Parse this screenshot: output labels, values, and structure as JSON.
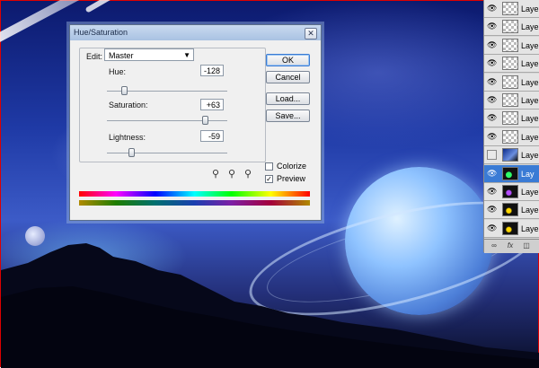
{
  "dialog": {
    "title": "Hue/Saturation",
    "edit_label": "Edit:",
    "edit_value": "Master",
    "hue": {
      "label": "Hue:",
      "value": "-128",
      "level": -128,
      "min": -180,
      "max": 180
    },
    "saturation": {
      "label": "Saturation:",
      "value": "+63",
      "level": 63,
      "min": -100,
      "max": 100
    },
    "lightness": {
      "label": "Lightness:",
      "value": "-59",
      "level": -59,
      "min": -100,
      "max": 100
    },
    "buttons": {
      "ok": "OK",
      "cancel": "Cancel",
      "load": "Load...",
      "save": "Save..."
    },
    "colorize": {
      "label": "Colorize",
      "checked": false
    },
    "preview": {
      "label": "Preview",
      "checked": true
    },
    "close_icon": "close-icon",
    "eyedropper_icons": [
      "eyedropper-icon",
      "eyedropper-plus-icon",
      "eyedropper-minus-icon"
    ]
  },
  "layers": {
    "rows": [
      {
        "name": "Laye",
        "visible": true,
        "thumb": "transparent",
        "selected": false
      },
      {
        "name": "Laye",
        "visible": true,
        "thumb": "transparent",
        "selected": false
      },
      {
        "name": "Laye",
        "visible": true,
        "thumb": "transparent",
        "selected": false
      },
      {
        "name": "Laye",
        "visible": true,
        "thumb": "transparent",
        "selected": false
      },
      {
        "name": "Laye",
        "visible": true,
        "thumb": "transparent",
        "selected": false
      },
      {
        "name": "Laye",
        "visible": true,
        "thumb": "transparent",
        "selected": false
      },
      {
        "name": "Laye",
        "visible": true,
        "thumb": "transparent",
        "selected": false
      },
      {
        "name": "Laye",
        "visible": true,
        "thumb": "transparent",
        "selected": false
      },
      {
        "name": "Laye",
        "visible": false,
        "thumb": "img-a",
        "selected": false
      },
      {
        "name": "Lay",
        "visible": true,
        "thumb": "img-b",
        "selected": true
      },
      {
        "name": "Laye",
        "visible": true,
        "thumb": "img-d",
        "selected": false
      },
      {
        "name": "Laye",
        "visible": true,
        "thumb": "img-c",
        "selected": false
      },
      {
        "name": "Laye",
        "visible": true,
        "thumb": "img-c",
        "selected": false
      }
    ],
    "footer_icons": [
      "link-icon",
      "fx-icon",
      "mask-icon"
    ],
    "footer_fx": "fx"
  },
  "colors": {
    "selected_layer": "#3a7bd5",
    "canvas_border": "#dd0000"
  }
}
